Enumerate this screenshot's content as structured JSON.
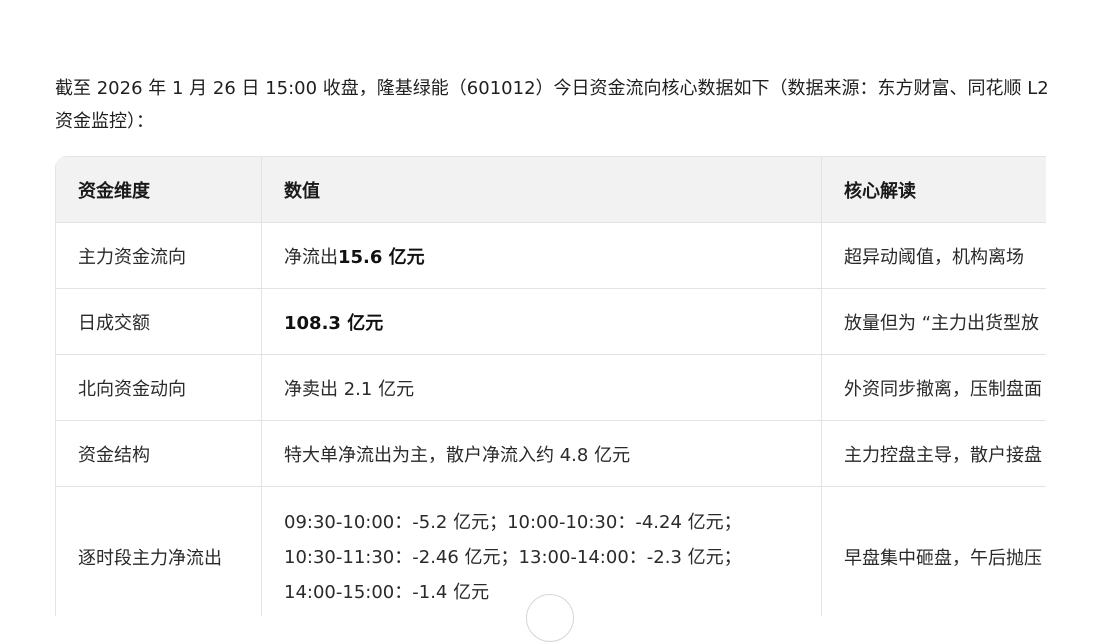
{
  "intro": {
    "text": "截至 2026 年 1 月 26 日 15:00 收盘，隆基绿能（601012）今日资金流向核心数据如下（数据来源：东方财富、同花顺 L2 资金监控）："
  },
  "table": {
    "headers": [
      "资金维度",
      "数值",
      "核心解读"
    ],
    "rows": [
      {
        "dimension": "主力资金流向",
        "value_prefix": "净流出",
        "value_bold": "15.6 亿元",
        "interpretation": "超异动阈值，机构离场"
      },
      {
        "dimension": "日成交额",
        "value_prefix": "",
        "value_bold": "108.3 亿元",
        "interpretation": "放量但为 “主力出货型放"
      },
      {
        "dimension": "北向资金动向",
        "value_prefix": "净卖出 2.1 亿元",
        "value_bold": "",
        "interpretation": "外资同步撤离，压制盘面"
      },
      {
        "dimension": "资金结构",
        "value_prefix": "特大单净流出为主，散户净流入约 4.8 亿元",
        "value_bold": "",
        "interpretation": "主力控盘主导，散户接盘"
      },
      {
        "dimension": "逐时段主力净流出",
        "value_prefix": "09:30-10:00：-5.2 亿元；10:00-10:30：-4.24 亿元；10:30-11:30：-2.46 亿元；13:00-14:00：-2.3 亿元；14:00-15:00：-1.4 亿元",
        "value_bold": "",
        "interpretation": "早盘集中砸盘，午后抛压"
      }
    ]
  }
}
